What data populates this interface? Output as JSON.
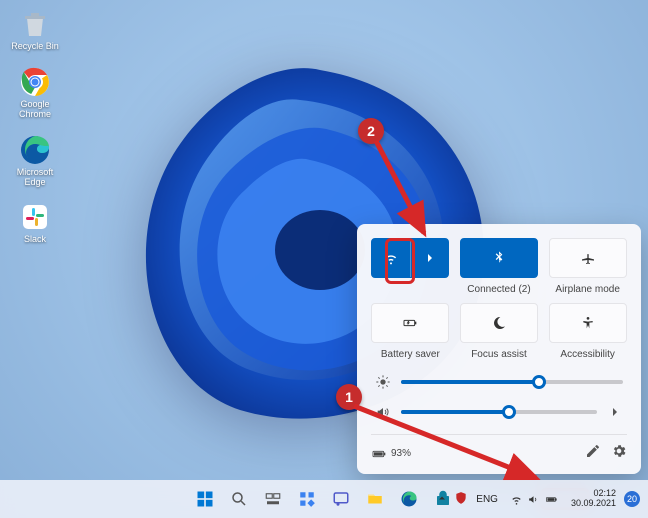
{
  "desktop": {
    "icons": [
      {
        "name": "recycle-bin",
        "label": "Recycle Bin"
      },
      {
        "name": "google-chrome",
        "label": "Google Chrome"
      },
      {
        "name": "microsoft-edge",
        "label": "Microsoft Edge"
      },
      {
        "name": "slack",
        "label": "Slack"
      }
    ]
  },
  "quick_settings": {
    "tiles": {
      "wifi": {
        "label": "",
        "active": true
      },
      "bluetooth": {
        "label": "Connected (2)",
        "active": true
      },
      "airplane": {
        "label": "Airplane mode",
        "active": false
      },
      "battery_saver": {
        "label": "Battery saver",
        "active": false
      },
      "focus_assist": {
        "label": "Focus assist",
        "active": false
      },
      "accessibility": {
        "label": "Accessibility",
        "active": false
      }
    },
    "brightness": 62,
    "volume": 55,
    "battery_text": "93%"
  },
  "taskbar": {
    "language": "ENG",
    "time": "02:12",
    "date": "30.09.2021",
    "notification_count": "20"
  },
  "annotations": {
    "step1": "1",
    "step2": "2"
  }
}
